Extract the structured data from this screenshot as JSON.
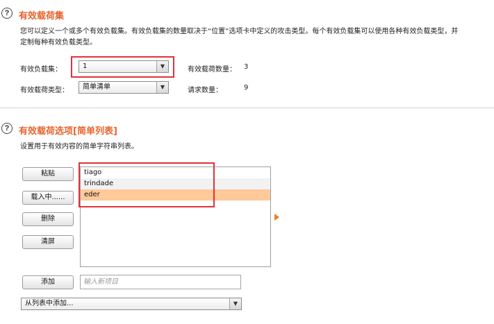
{
  "payload_sets": {
    "title": "有效载荷集",
    "description_line1": "您可以定义一个或多个有效负载集。有效负载集的数量取决于“位置”选项卡中定义的攻击类型。每个有效负载集可以使用各种有效负载类型，并",
    "description_line2": "定制每种有效负载类型。",
    "payload_set_label": "有效负载集：",
    "payload_set_value": "1",
    "payload_count_label": "有效载荷数量：",
    "payload_count_value": "3",
    "payload_type_label": "有效载荷类型：",
    "payload_type_value": "简单清单",
    "request_count_label": "请求数量：",
    "request_count_value": "9"
  },
  "payload_options": {
    "title": "有效载荷选项[简单列表]",
    "description": "设置用于有效内容的简单字符串列表。",
    "buttons": {
      "paste": "粘贴",
      "load": "载入中......",
      "remove": "删除",
      "clear": "清屏",
      "add": "添加"
    },
    "list_items": [
      "tiago",
      "trindade",
      "eder"
    ],
    "selected_index": 2,
    "new_item_placeholder": "输入新项目",
    "add_from_list": "从列表中添加..."
  },
  "colors": {
    "accent": "#e8642d",
    "highlight_box": "#e0313a",
    "selection": "#ffc99a"
  },
  "icons": {
    "help": "help-icon",
    "dropdown": "chevron-down-icon",
    "expand": "play-arrow-icon"
  }
}
